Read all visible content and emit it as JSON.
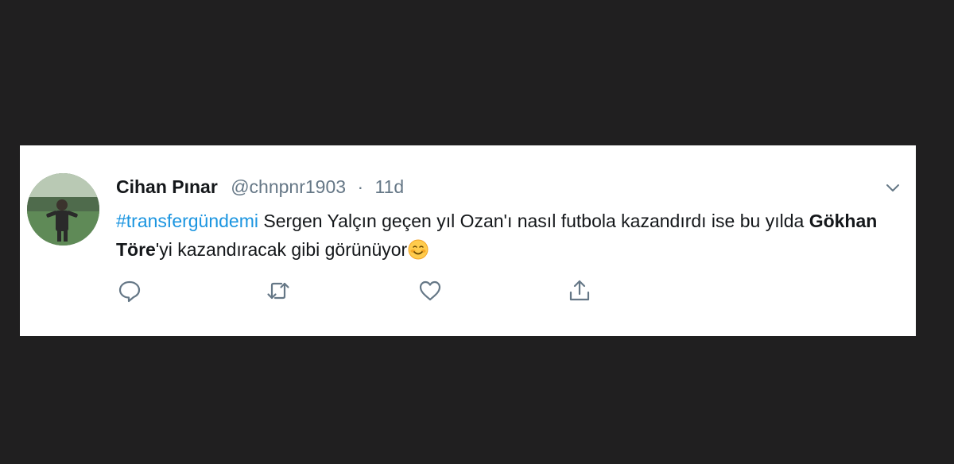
{
  "tweet": {
    "display_name": "Cihan Pınar",
    "handle": "@chnpnr1903",
    "separator": "·",
    "time": "11d",
    "hashtag": "#transfergündemi",
    "text_part1": " Sergen Yalçın geçen yıl Ozan'ı nasıl futbola kazandırdı ise bu yılda ",
    "bold_name": "Gökhan Töre",
    "text_part2": "'yi kazandıracak gibi görünüyor",
    "emoji": "smiling-face-emoji"
  },
  "icons": {
    "more": "chevron-down-icon",
    "reply": "reply-icon",
    "retweet": "retweet-icon",
    "like": "heart-icon",
    "share": "share-icon"
  },
  "colors": {
    "background": "#201f20",
    "card": "#ffffff",
    "hashtag": "#1b95e0",
    "secondary_text": "#657786",
    "primary_text": "#14171a",
    "icon": "#657786"
  }
}
